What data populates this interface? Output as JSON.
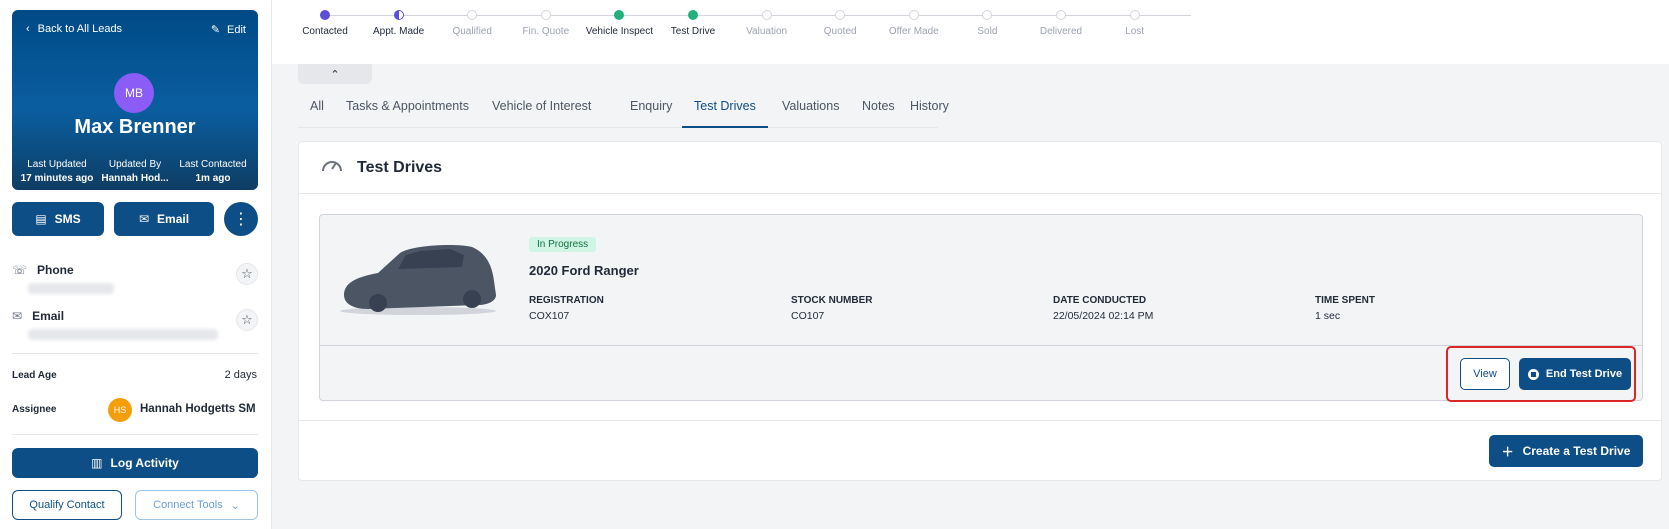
{
  "lead": {
    "back_label": "Back to All Leads",
    "edit_label": "Edit",
    "initials": "MB",
    "name": "Max Brenner",
    "meta": [
      {
        "label": "Last Updated",
        "value": "17 minutes ago"
      },
      {
        "label": "Updated By",
        "value": "Hannah Hod..."
      },
      {
        "label": "Last Contacted",
        "value": "1m ago"
      }
    ],
    "sms_label": "SMS",
    "email_btn_label": "Email",
    "phone_label": "Phone",
    "email_label": "Email",
    "lead_age_label": "Lead Age",
    "lead_age_value": "2 days",
    "assignee_label": "Assignee",
    "assignee_initials": "HS",
    "assignee_name": "Hannah Hodgetts SM",
    "log_activity_label": "Log Activity",
    "qualify_label": "Qualify Contact",
    "connect_label": "Connect Tools"
  },
  "stepper": [
    {
      "label": "Contacted",
      "state": "purple"
    },
    {
      "label": "Appt. Made",
      "state": "half"
    },
    {
      "label": "Qualified",
      "state": "empty"
    },
    {
      "label": "Fin. Quote",
      "state": "empty"
    },
    {
      "label": "Vehicle Inspect",
      "state": "green"
    },
    {
      "label": "Test Drive",
      "state": "green"
    },
    {
      "label": "Valuation",
      "state": "empty"
    },
    {
      "label": "Quoted",
      "state": "empty"
    },
    {
      "label": "Offer Made",
      "state": "empty"
    },
    {
      "label": "Sold",
      "state": "empty"
    },
    {
      "label": "Delivered",
      "state": "empty"
    },
    {
      "label": "Lost",
      "state": "empty"
    }
  ],
  "tabs": [
    "All",
    "Tasks & Appointments",
    "Vehicle of Interest",
    "Enquiry",
    "Test Drives",
    "Valuations",
    "Notes",
    "History"
  ],
  "active_tab": "Test Drives",
  "panel": {
    "title": "Test Drives",
    "status": "In Progress",
    "vehicle": "2020 Ford Ranger",
    "fields": [
      {
        "label": "REGISTRATION",
        "value": "COX107"
      },
      {
        "label": "STOCK NUMBER",
        "value": "CO107"
      },
      {
        "label": "DATE CONDUCTED",
        "value": "22/05/2024 02:14 PM"
      },
      {
        "label": "TIME SPENT",
        "value": "1 sec"
      }
    ],
    "view_label": "View",
    "end_label": "End Test Drive",
    "create_label": "Create a Test Drive"
  },
  "colors": {
    "primary": "#0e4e86",
    "progress_purple": "#5b4fd8",
    "progress_green": "#22b07d",
    "highlight_red": "#dc2626"
  }
}
